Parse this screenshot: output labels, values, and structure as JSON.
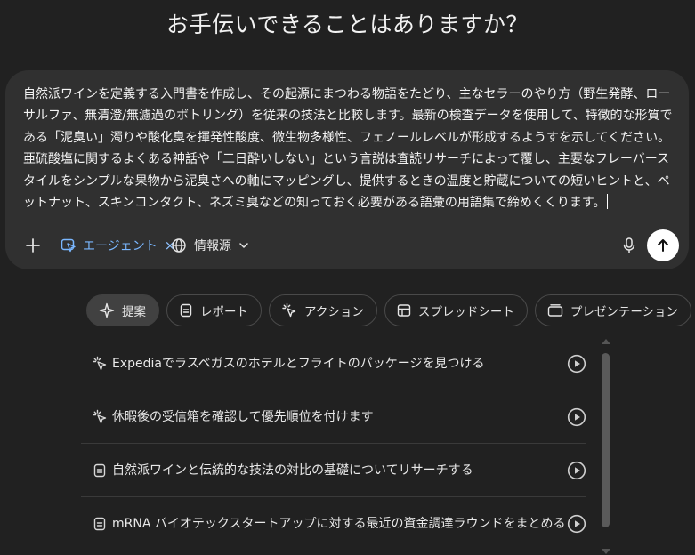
{
  "heading": "お手伝いできることはありますか？",
  "composer": {
    "prompt": "自然派ワインを定義する入門書を作成し、その起源にまつわる物語をたどり、主なセラーのやり方（野生発酵、ローサルファ、無清澄/無濾過のボトリング）を従来の技法と比較します。最新の検査データを使用して、特徴的な形質である「泥臭い」濁りや酸化臭を揮発性酸度、微生物多様性、フェノールレベルが形成するようすを示してください。亜硫酸塩に関するよくある神話や「二日酔いしない」という言説は査読リサーチによって覆し、主要なフレーバースタイルをシンプルな果物から泥臭さへの軸にマッピングし、提供するときの温度と貯蔵についての短いヒントと、ペットナット、スキンコンタクト、ネズミ臭などの知っておく必要がある語彙の用語集で締めくくります。",
    "toolbar": {
      "plus_icon": "plus-icon",
      "agent_label": "エージェント",
      "agent_icon": "agent-cursor-icon",
      "sources_label": "情報源",
      "sources_icon": "globe-icon",
      "mic_icon": "microphone-icon",
      "send_icon": "arrow-up-icon"
    }
  },
  "tabs": [
    {
      "label": "提案",
      "icon": "sparkle-icon",
      "active": true
    },
    {
      "label": "レポート",
      "icon": "document-icon",
      "active": false
    },
    {
      "label": "アクション",
      "icon": "click-cursor-icon",
      "active": false
    },
    {
      "label": "スプレッドシート",
      "icon": "table-icon",
      "active": false
    },
    {
      "label": "プレゼンテーション",
      "icon": "slides-icon",
      "active": false
    }
  ],
  "suggestions": [
    {
      "text": "Expediaでラスベガスのホテルとフライトのパッケージを見つける",
      "icon": "click-cursor-icon"
    },
    {
      "text": "休暇後の受信箱を確認して優先順位を付けます",
      "icon": "click-cursor-icon"
    },
    {
      "text": "自然派ワインと伝統的な技法の対比の基礎についてリサーチする",
      "icon": "document-icon"
    },
    {
      "text": "mRNA バイオテックスタートアップに対する最近の資金調達ラウンドをまとめる",
      "icon": "document-icon"
    }
  ],
  "colors": {
    "background": "#212121",
    "composer": "#303030",
    "agent_accent": "#7ab7ff",
    "send_button": "#ffffff"
  }
}
